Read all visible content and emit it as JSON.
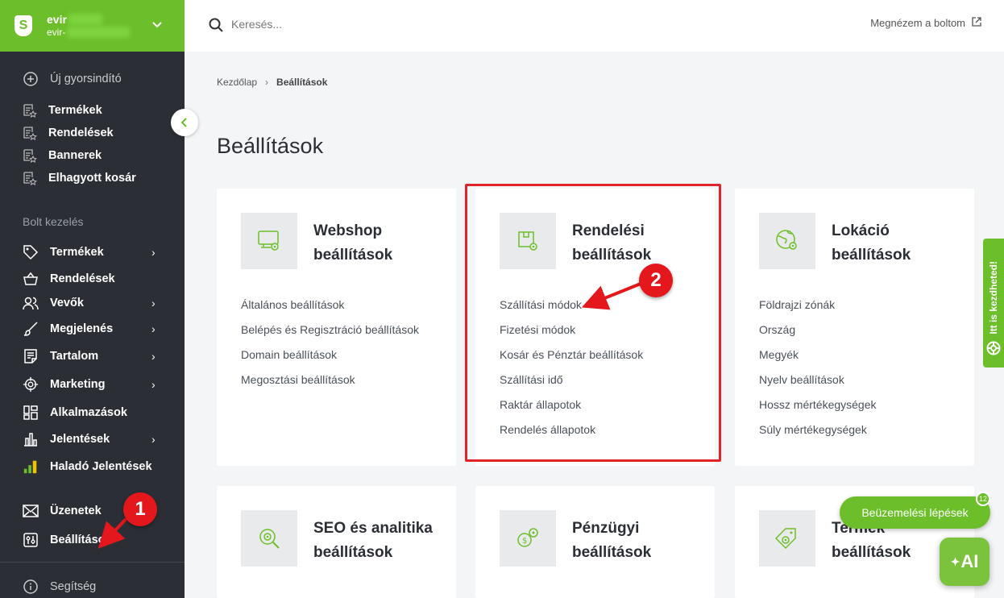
{
  "shop": {
    "name": "evir",
    "sub": "evir-"
  },
  "sidebar": {
    "quick_start": "Új gyorsindító",
    "shortcuts": [
      "Termékek",
      "Rendelések",
      "Bannerek",
      "Elhagyott kosár"
    ],
    "section_title": "Bolt kezelés",
    "items": [
      {
        "label": "Termékek",
        "icon": "tag-icon"
      },
      {
        "label": "Rendelések",
        "icon": "basket-icon"
      },
      {
        "label": "Vevők",
        "icon": "users-icon"
      },
      {
        "label": "Megjelenés",
        "icon": "brush-icon"
      },
      {
        "label": "Tartalom",
        "icon": "document-icon"
      },
      {
        "label": "Marketing",
        "icon": "target-icon"
      },
      {
        "label": "Alkalmazások",
        "icon": "apps-icon"
      },
      {
        "label": "Jelentések",
        "icon": "bar-chart-icon"
      },
      {
        "label": "Haladó Jelentések",
        "icon": "advanced-chart-icon"
      }
    ],
    "messages": "Üzenetek",
    "settings": "Beállítások",
    "help": "Segítség"
  },
  "topbar": {
    "search_placeholder": "Keresés...",
    "view_shop": "Megnézem a boltom"
  },
  "breadcrumb": {
    "home": "Kezdőlap",
    "current": "Beállítások"
  },
  "page_title": "Beállítások",
  "cards": [
    {
      "title": "Webshop beállítások",
      "links": [
        "Általános beállítások",
        "Belépés és Regisztráció beállítások",
        "Domain beállítások",
        "Megosztási beállítások"
      ]
    },
    {
      "title": "Rendelési beállítások",
      "links": [
        "Szállítási módok",
        "Fizetési módok",
        "Kosár és Pénztár beállítások",
        "Szállítási idő",
        "Raktár állapotok",
        "Rendelés állapotok"
      ]
    },
    {
      "title": "Lokáció beállítások",
      "links": [
        "Földrajzi zónák",
        "Ország",
        "Megyék",
        "Nyelv beállítások",
        "Hossz mértékegységek",
        "Súly mértékegységek"
      ]
    },
    {
      "title": "SEO és analitika beállítások"
    },
    {
      "title": "Pénzügyi beállítások"
    },
    {
      "title": "Termék beállítások"
    }
  ],
  "annotations": {
    "one": "1",
    "two": "2"
  },
  "side_tab": "Itt is kezdheted!",
  "onboarding": {
    "label": "Beüzemelési lépések",
    "count": "12"
  },
  "ai_button": "AI",
  "colors": {
    "brand": "#6cbf2a",
    "sidebar": "#2b2f35",
    "highlight": "#e0242a"
  }
}
